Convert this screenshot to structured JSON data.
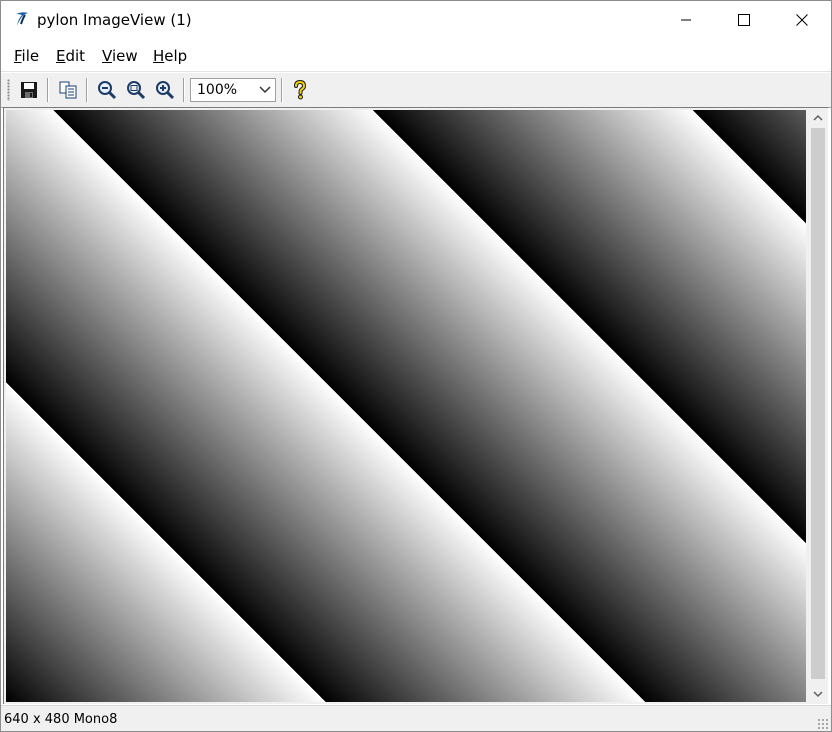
{
  "window": {
    "title": "pylon ImageView (1)",
    "accent": "#1e5fa8"
  },
  "menu": {
    "items": [
      "File",
      "Edit",
      "View",
      "Help"
    ]
  },
  "toolbar": {
    "buttons": [
      "save-icon",
      "copy-icon",
      "zoom-out-icon",
      "zoom-fit-icon",
      "zoom-in-icon",
      "help-icon"
    ],
    "zoom_value": "100%"
  },
  "image": {
    "pattern": "diagonal grayscale ramp stripes",
    "colors": [
      "#000000",
      "#ffffff"
    ]
  },
  "status": {
    "text": "640 x 480 Mono8"
  }
}
